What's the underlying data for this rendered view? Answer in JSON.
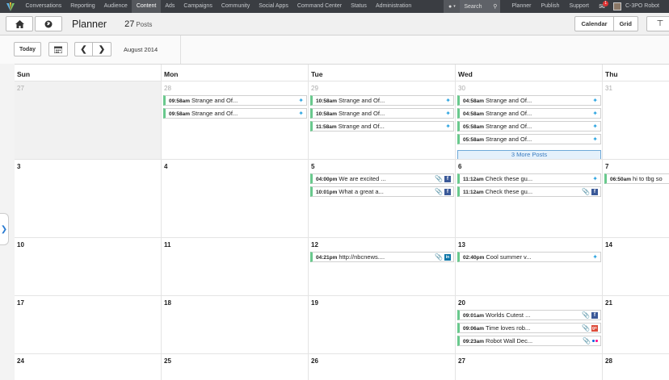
{
  "topnav": {
    "items": [
      "Conversations",
      "Reporting",
      "Audience",
      "Content",
      "Ads",
      "Campaigns",
      "Community",
      "Social Apps",
      "Command Center",
      "Status",
      "Administration"
    ],
    "active_index": 3,
    "search_placeholder": "Search",
    "right_items": [
      "Planner",
      "Publish",
      "Support"
    ],
    "notification_count": "1",
    "user_name": "C-3PO Robot"
  },
  "header": {
    "title": "Planner",
    "post_count": "27",
    "post_count_label": "Posts",
    "view_buttons": [
      "Calendar",
      "Grid"
    ]
  },
  "toolbar": {
    "today_label": "Today",
    "month_label": "August 2014"
  },
  "calendar": {
    "days_of_week": [
      "Sun",
      "Mon",
      "Tue",
      "Wed",
      "Thu"
    ],
    "weeks": [
      {
        "dates": [
          "27",
          "28",
          "29",
          "30",
          "31"
        ],
        "muted": true
      },
      {
        "dates": [
          "3",
          "4",
          "5",
          "6",
          "7"
        ],
        "muted": false
      },
      {
        "dates": [
          "10",
          "11",
          "12",
          "13",
          "14"
        ],
        "muted": false
      },
      {
        "dates": [
          "17",
          "18",
          "19",
          "20",
          "21"
        ],
        "muted": false
      },
      {
        "dates": [
          "24",
          "25",
          "26",
          "27",
          "28"
        ],
        "muted": false
      }
    ],
    "posts": [
      {
        "week": 0,
        "day": 1,
        "slot": 0,
        "time": "09:58am",
        "text": "Strange and Of...",
        "icons": [
          "twitter"
        ]
      },
      {
        "week": 0,
        "day": 1,
        "slot": 1,
        "time": "09:58am",
        "text": "Strange and Of...",
        "icons": [
          "twitter"
        ]
      },
      {
        "week": 0,
        "day": 2,
        "slot": 0,
        "time": "10:58am",
        "text": "Strange and Of...",
        "icons": [
          "twitter"
        ]
      },
      {
        "week": 0,
        "day": 2,
        "slot": 1,
        "time": "10:58am",
        "text": "Strange and Of...",
        "icons": [
          "twitter"
        ]
      },
      {
        "week": 0,
        "day": 2,
        "slot": 2,
        "time": "11:58am",
        "text": "Strange and Of...",
        "icons": [
          "twitter"
        ]
      },
      {
        "week": 0,
        "day": 3,
        "slot": 0,
        "time": "04:58am",
        "text": "Strange and Of...",
        "icons": [
          "twitter"
        ]
      },
      {
        "week": 0,
        "day": 3,
        "slot": 1,
        "time": "04:58am",
        "text": "Strange and Of...",
        "icons": [
          "twitter"
        ]
      },
      {
        "week": 0,
        "day": 3,
        "slot": 2,
        "time": "05:58am",
        "text": "Strange and Of...",
        "icons": [
          "twitter"
        ]
      },
      {
        "week": 0,
        "day": 3,
        "slot": 3,
        "time": "05:58am",
        "text": "Strange and Of...",
        "icons": [
          "twitter"
        ]
      },
      {
        "week": 1,
        "day": 2,
        "slot": 0,
        "time": "04:00pm",
        "text": "We are excited ...",
        "icons": [
          "paperclip",
          "facebook"
        ]
      },
      {
        "week": 1,
        "day": 2,
        "slot": 1,
        "time": "10:01pm",
        "text": "What a great a...",
        "icons": [
          "paperclip",
          "facebook"
        ]
      },
      {
        "week": 1,
        "day": 3,
        "slot": 0,
        "time": "11:12am",
        "text": "Check these gu...",
        "icons": [
          "twitter"
        ]
      },
      {
        "week": 1,
        "day": 3,
        "slot": 1,
        "time": "11:12am",
        "text": "Check these gu...",
        "icons": [
          "paperclip",
          "facebook"
        ]
      },
      {
        "week": 1,
        "day": 4,
        "slot": 0,
        "time": "06:50am",
        "text": "hi to tbg so",
        "icons": []
      },
      {
        "week": 2,
        "day": 2,
        "slot": 0,
        "time": "04:21pm",
        "text": "http://nbcnews....",
        "icons": [
          "paperclip",
          "linkedin"
        ]
      },
      {
        "week": 2,
        "day": 3,
        "slot": 0,
        "time": "02:40pm",
        "text": "Cool summer v...",
        "icons": [
          "twitter"
        ]
      },
      {
        "week": 3,
        "day": 3,
        "slot": 0,
        "time": "09:01am",
        "text": "Worlds Cutest ...",
        "icons": [
          "paperclip",
          "facebook"
        ]
      },
      {
        "week": 3,
        "day": 3,
        "slot": 1,
        "time": "09:06am",
        "text": "Time loves rob...",
        "icons": [
          "paperclip",
          "googleplus"
        ]
      },
      {
        "week": 3,
        "day": 3,
        "slot": 2,
        "time": "09:23am",
        "text": "Robot Wall Dec...",
        "icons": [
          "paperclip",
          "flickr"
        ]
      }
    ],
    "more_posts": {
      "week": 0,
      "day": 3,
      "label": "3 More Posts"
    }
  },
  "colors": {
    "nav_bg": "#3a3d42",
    "post_accent": "#69c98d",
    "twitter": "#2aa3e0",
    "facebook": "#3b5998",
    "linkedin": "#0e76a8",
    "googleplus": "#dd4b39",
    "more_link": "#3b7cbf"
  }
}
